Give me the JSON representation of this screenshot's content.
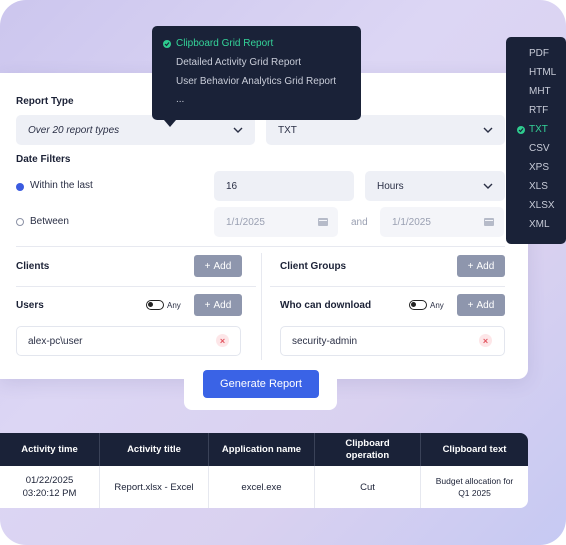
{
  "form": {
    "report_type_label": "Report Type",
    "report_type_value": "Over 20 report types",
    "format_value": "TXT",
    "date_filters_label": "Date Filters",
    "within_label": "Within the last",
    "within_value": "16",
    "unit_value": "Hours",
    "between_label": "Between",
    "from_date": "1/1/2025",
    "and_label": "and",
    "to_date": "1/1/2025",
    "clients_label": "Clients",
    "client_groups_label": "Client Groups",
    "users_label": "Users",
    "who_can_download_label": "Who can download",
    "any_label": "Any",
    "add_label": "Add",
    "user_tag": "alex-pc\\user",
    "download_tag": "security-admin",
    "generate_button": "Generate Report"
  },
  "report_type_dropdown": {
    "items": [
      {
        "label": "Clipboard Grid Report",
        "selected": true
      },
      {
        "label": "Detailed Activity Grid Report",
        "selected": false
      },
      {
        "label": "User Behavior Analytics Grid Report",
        "selected": false
      },
      {
        "label": "...",
        "selected": false
      }
    ]
  },
  "format_dropdown": {
    "items": [
      {
        "label": "PDF",
        "selected": false
      },
      {
        "label": "HTML",
        "selected": false
      },
      {
        "label": "MHT",
        "selected": false
      },
      {
        "label": "RTF",
        "selected": false
      },
      {
        "label": "TXT",
        "selected": true
      },
      {
        "label": "CSV",
        "selected": false
      },
      {
        "label": "XPS",
        "selected": false
      },
      {
        "label": "XLS",
        "selected": false
      },
      {
        "label": "XLSX",
        "selected": false
      },
      {
        "label": "XML",
        "selected": false
      }
    ]
  },
  "table": {
    "headers": [
      "Activity time",
      "Activity title",
      "Application name",
      "Clipboard operation",
      "Clipboard text"
    ],
    "rows": [
      [
        "01/22/2025 03:20:12 PM",
        "Report.xlsx - Excel",
        "excel.exe",
        "Cut",
        "Budget allocation for Q1 2025"
      ]
    ]
  },
  "colors": {
    "accent": "#3a63e6",
    "dark": "#1a2238",
    "selected_check": "#2ecc8f"
  }
}
